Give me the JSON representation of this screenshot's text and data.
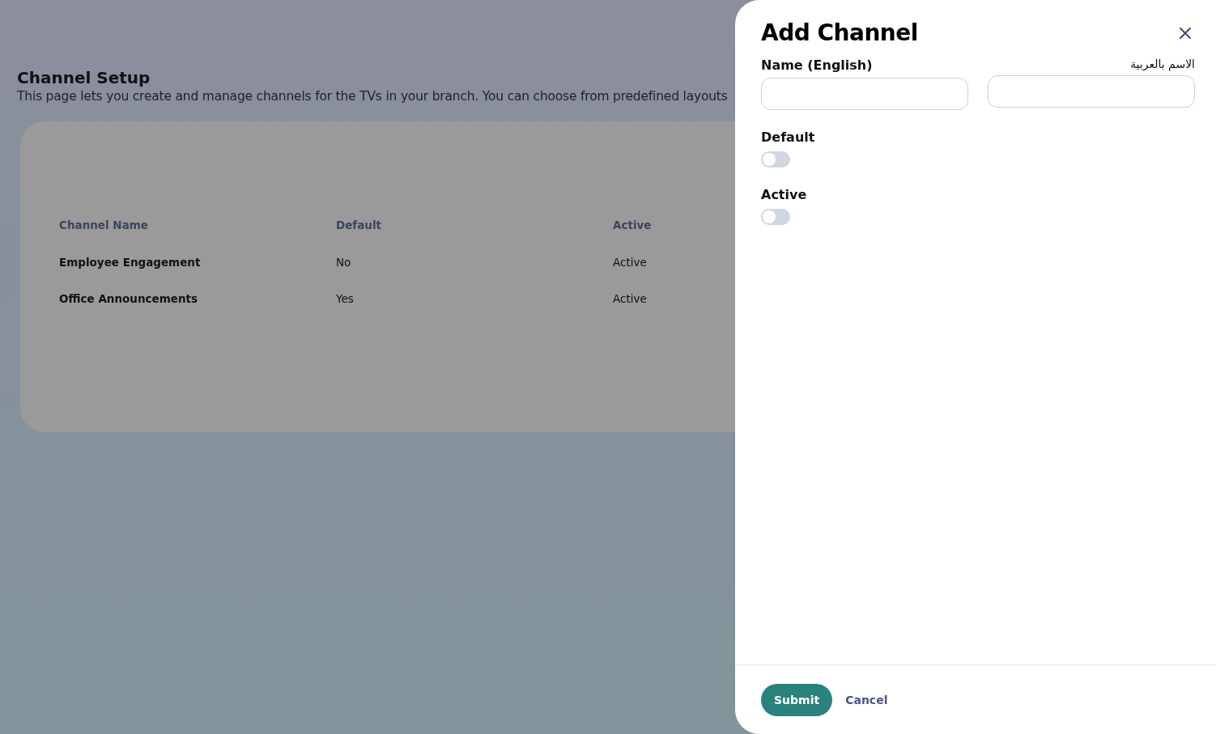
{
  "page": {
    "title": "Channel Setup",
    "description": "This page lets you create and manage channels for the TVs in your branch. You can choose from predefined layouts"
  },
  "table": {
    "columns": [
      "Channel Name",
      "Default",
      "Active"
    ],
    "rows": [
      [
        "Employee Engagement",
        "No",
        "Active"
      ],
      [
        "Office Announcements",
        "Yes",
        "Active"
      ]
    ]
  },
  "drawer": {
    "title": "Add Channel",
    "fields": [
      {
        "label": "Name (English)",
        "kind": "ltr"
      },
      {
        "label": "الاسم بالعربية",
        "kind": "rtl"
      }
    ],
    "toggles": [
      {
        "label": "Default",
        "on": false
      },
      {
        "label": "Active",
        "on": false
      }
    ],
    "buttons": {
      "submit": "Submit",
      "cancel": "Cancel"
    }
  }
}
